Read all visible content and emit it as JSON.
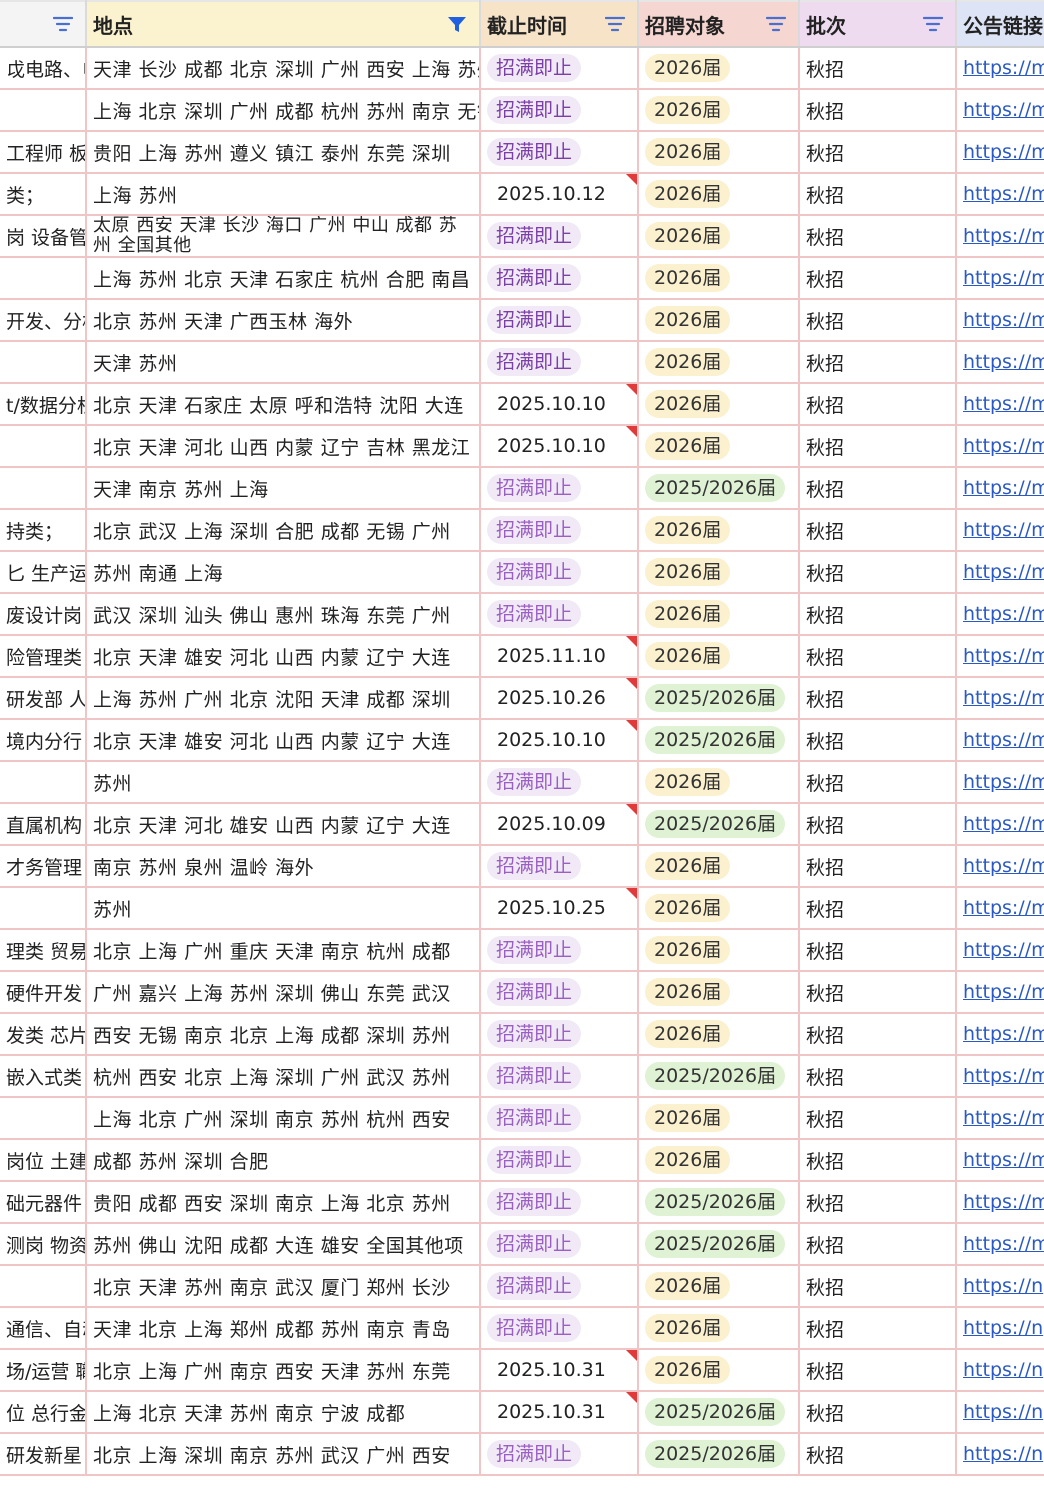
{
  "headers": {
    "col0": "",
    "col1": "地点",
    "col2": "截止时间",
    "col3": "招聘对象",
    "col4": "批次",
    "col5": "公告链接"
  },
  "rows": [
    {
      "c0": "戉电路、电",
      "c1": "天津 长沙 成都 北京 深圳 广州 西安 上海 苏州",
      "c2": "招满即止",
      "c3": "2026届",
      "c4": "秋招",
      "c5": "https://m"
    },
    {
      "c0": "",
      "c1": "上海 北京 深圳 广州 成都 杭州 苏州 南京 无锡",
      "c2": "招满即止",
      "c3": "2026届",
      "c4": "秋招",
      "c5": "https://m"
    },
    {
      "c0": "工程师 板卡",
      "c1": "贵阳 上海 苏州 遵义 镇江 泰州 东莞 深圳",
      "c2": "招满即止",
      "c3": "2026届",
      "c4": "秋招",
      "c5": "https://m"
    },
    {
      "c0": "类；",
      "c1": "上海 苏州",
      "c2": "2025.10.12",
      "c3": "2026届",
      "c4": "秋招",
      "c5": "https://m"
    },
    {
      "c0": "岗 设备管",
      "c1": "太原 西安 天津 长沙 海口 广州 中山 成都 苏州 全国其他",
      "c2": "招满即止",
      "c3": "2026届",
      "c4": "秋招",
      "c5": "https://m"
    },
    {
      "c0": "",
      "c1": "上海 苏州 北京 天津 石家庄 杭州 合肥 南昌",
      "c2": "招满即止",
      "c3": "2026届",
      "c4": "秋招",
      "c5": "https://m"
    },
    {
      "c0": "开发、分析",
      "c1": "北京 苏州 天津 广西玉林 海外",
      "c2": "招满即止",
      "c3": "2026届",
      "c4": "秋招",
      "c5": "https://m"
    },
    {
      "c0": "",
      "c1": "天津 苏州",
      "c2": "招满即止",
      "c3": "2026届",
      "c4": "秋招",
      "c5": "https://m"
    },
    {
      "c0": "t/数据分析",
      "c1": "北京 天津 石家庄 太原 呼和浩特 沈阳 大连",
      "c2": "2025.10.10",
      "c3": "2026届",
      "c4": "秋招",
      "c5": "https://m"
    },
    {
      "c0": "",
      "c1": "北京 天津 河北 山西 内蒙 辽宁 吉林 黑龙江",
      "c2": "2025.10.10",
      "c3": "2026届",
      "c4": "秋招",
      "c5": "https://m"
    },
    {
      "c0": "",
      "c1": "天津 南京 苏州 上海",
      "c2": "招满即止",
      "c3": "2025/2026届",
      "c4": "秋招",
      "c5": "https://m"
    },
    {
      "c0": "持类；",
      "c1": "北京 武汉 上海 深圳 合肥 成都 无锡 广州",
      "c2": "招满即止",
      "c3": "2026届",
      "c4": "秋招",
      "c5": "https://m"
    },
    {
      "c0": "匕 生产运营",
      "c1": "苏州 南通 上海",
      "c2": "招满即止",
      "c3": "2026届",
      "c4": "秋招",
      "c5": "https://m"
    },
    {
      "c0": "废设计岗",
      "c1": "武汉 深圳 汕头 佛山 惠州 珠海 东莞 广州",
      "c2": "招满即止",
      "c3": "2026届",
      "c4": "秋招",
      "c5": "https://m"
    },
    {
      "c0": "险管理类",
      "c1": "北京 天津 雄安 河北 山西 内蒙 辽宁 大连",
      "c2": "2025.11.10",
      "c3": "2026届",
      "c4": "秋招",
      "c5": "https://m"
    },
    {
      "c0": " 研发部 人",
      "c1": "上海 苏州 广州 北京 沈阳 天津 成都 深圳",
      "c2": "2025.10.26",
      "c3": "2025/2026届",
      "c4": "秋招",
      "c5": "https://m"
    },
    {
      "c0": "境内分行 海",
      "c1": "北京 天津 雄安 河北 山西 内蒙 辽宁 大连",
      "c2": "2025.10.10",
      "c3": "2025/2026届",
      "c4": "秋招",
      "c5": "https://m"
    },
    {
      "c0": "",
      "c1": "苏州",
      "c2": "招满即止",
      "c3": "2026届",
      "c4": "秋招",
      "c5": "https://m"
    },
    {
      "c0": "直属机构",
      "c1": "北京 天津 河北 雄安 山西 内蒙 辽宁 大连",
      "c2": "2025.10.09",
      "c3": "2025/2026届",
      "c4": "秋招",
      "c5": "https://m"
    },
    {
      "c0": "才务管理 会",
      "c1": "南京 苏州 泉州 温岭 海外",
      "c2": "招满即止",
      "c3": "2026届",
      "c4": "秋招",
      "c5": "https://m"
    },
    {
      "c0": "",
      "c1": "苏州",
      "c2": "2025.10.25",
      "c3": "2026届",
      "c4": "秋招",
      "c5": "https://m"
    },
    {
      "c0": "理类 贸易",
      "c1": "北京 上海 广州 重庆 天津 南京 杭州 成都",
      "c2": "招满即止",
      "c3": "2026届",
      "c4": "秋招",
      "c5": "https://m"
    },
    {
      "c0": " 硬件开发",
      "c1": "广州 嘉兴 上海 苏州 深圳 佛山 东莞 武汉",
      "c2": "招满即止",
      "c3": "2026届",
      "c4": "秋招",
      "c5": "https://m"
    },
    {
      "c0": "发类 芯片",
      "c1": "西安 无锡 南京 北京 上海 成都 深圳 苏州",
      "c2": "招满即止",
      "c3": "2026届",
      "c4": "秋招",
      "c5": "https://m"
    },
    {
      "c0": "嵌入式类",
      "c1": "杭州 西安 北京 上海 深圳 广州 武汉 苏州",
      "c2": "招满即止",
      "c3": "2025/2026届",
      "c4": "秋招",
      "c5": "https://m"
    },
    {
      "c0": "",
      "c1": "上海 北京 广州 深圳 南京 苏州 杭州 西安",
      "c2": "招满即止",
      "c3": "2026届",
      "c4": "秋招",
      "c5": "https://m"
    },
    {
      "c0": "岗位 土建",
      "c1": "成都 苏州 深圳 合肥",
      "c2": "招满即止",
      "c3": "2026届",
      "c4": "秋招",
      "c5": "https://m"
    },
    {
      "c0": "础元器件",
      "c1": "贵阳 成都 西安 深圳 南京 上海 北京 苏州",
      "c2": "招满即止",
      "c3": "2025/2026届",
      "c4": "秋招",
      "c5": "https://m"
    },
    {
      "c0": "测岗 物资",
      "c1": "苏州 佛山 沈阳 成都 大连 雄安 全国其他项",
      "c2": "招满即止",
      "c3": "2025/2026届",
      "c4": "秋招",
      "c5": "https://m"
    },
    {
      "c0": "",
      "c1": "北京 天津 苏州 南京 武汉 厦门 郑州 长沙",
      "c2": "招满即止",
      "c3": "2026届",
      "c4": "秋招",
      "c5": "https://n"
    },
    {
      "c0": "通信、自动",
      "c1": "天津 北京 上海 郑州 成都 苏州 南京 青岛",
      "c2": "招满即止",
      "c3": "2026届",
      "c4": "秋招",
      "c5": "https://n"
    },
    {
      "c0": "场/运营 職",
      "c1": "北京 上海 广州 南京 西安 天津 苏州 东莞",
      "c2": "2025.10.31",
      "c3": "2026届",
      "c4": "秋招",
      "c5": "https://n"
    },
    {
      "c0": "位 总行金",
      "c1": "上海 北京 天津 苏州 南京 宁波 成都",
      "c2": "2025.10.31",
      "c3": "2025/2026届",
      "c4": "秋招",
      "c5": "https://n"
    },
    {
      "c0": " 研发新星",
      "c1": "北京 上海 深圳 南京 苏州 武汉 广州 西安",
      "c2": "招满即止",
      "c3": "2025/2026届",
      "c4": "秋招",
      "c5": "https://n"
    }
  ],
  "colors": {
    "filter_icon": "#4a6fd1",
    "filter_icon_active": "#1f5fe0",
    "comment_flag": "#e03a3a",
    "pill_purple": "#f1eaf6",
    "pill_yellow": "#fbf1cf",
    "pill_green": "#dff2d4"
  }
}
